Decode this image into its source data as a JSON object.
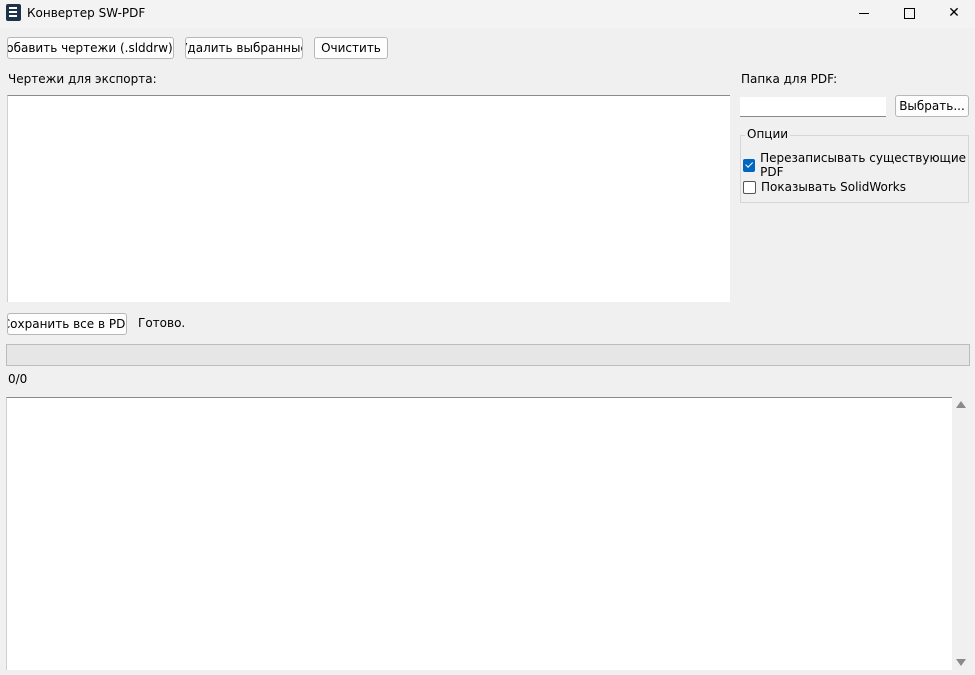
{
  "window": {
    "title": "Конвертер SW-PDF",
    "icon": "app-icon",
    "controls": {
      "minimize": "minimize-icon",
      "maximize": "maximize-icon",
      "close": "✕"
    }
  },
  "toolbar": {
    "add_label": "Добавить чертежи (.slddrw)...",
    "remove_label": "Удалить выбранные",
    "clear_label": "Очистить"
  },
  "drawings": {
    "label": "Чертежи для экспорта:",
    "items": []
  },
  "output": {
    "folder_label": "Папка для PDF:",
    "folder_value": "",
    "browse_label": "Выбрать..."
  },
  "options": {
    "title": "Опции",
    "overwrite": {
      "label": "Перезаписывать существующие PDF",
      "checked": true
    },
    "show_solidworks": {
      "label": "Показывать SolidWorks",
      "checked": false
    }
  },
  "actions": {
    "save_label": "Сохранить все в PDF",
    "status": "Готово."
  },
  "progress": {
    "fraction": 0,
    "counter": "0/0"
  },
  "log": {
    "text": ""
  },
  "colors": {
    "accent": "#0067c0",
    "window_bg": "#f0f0f0",
    "progress_fill": "#06b025"
  }
}
